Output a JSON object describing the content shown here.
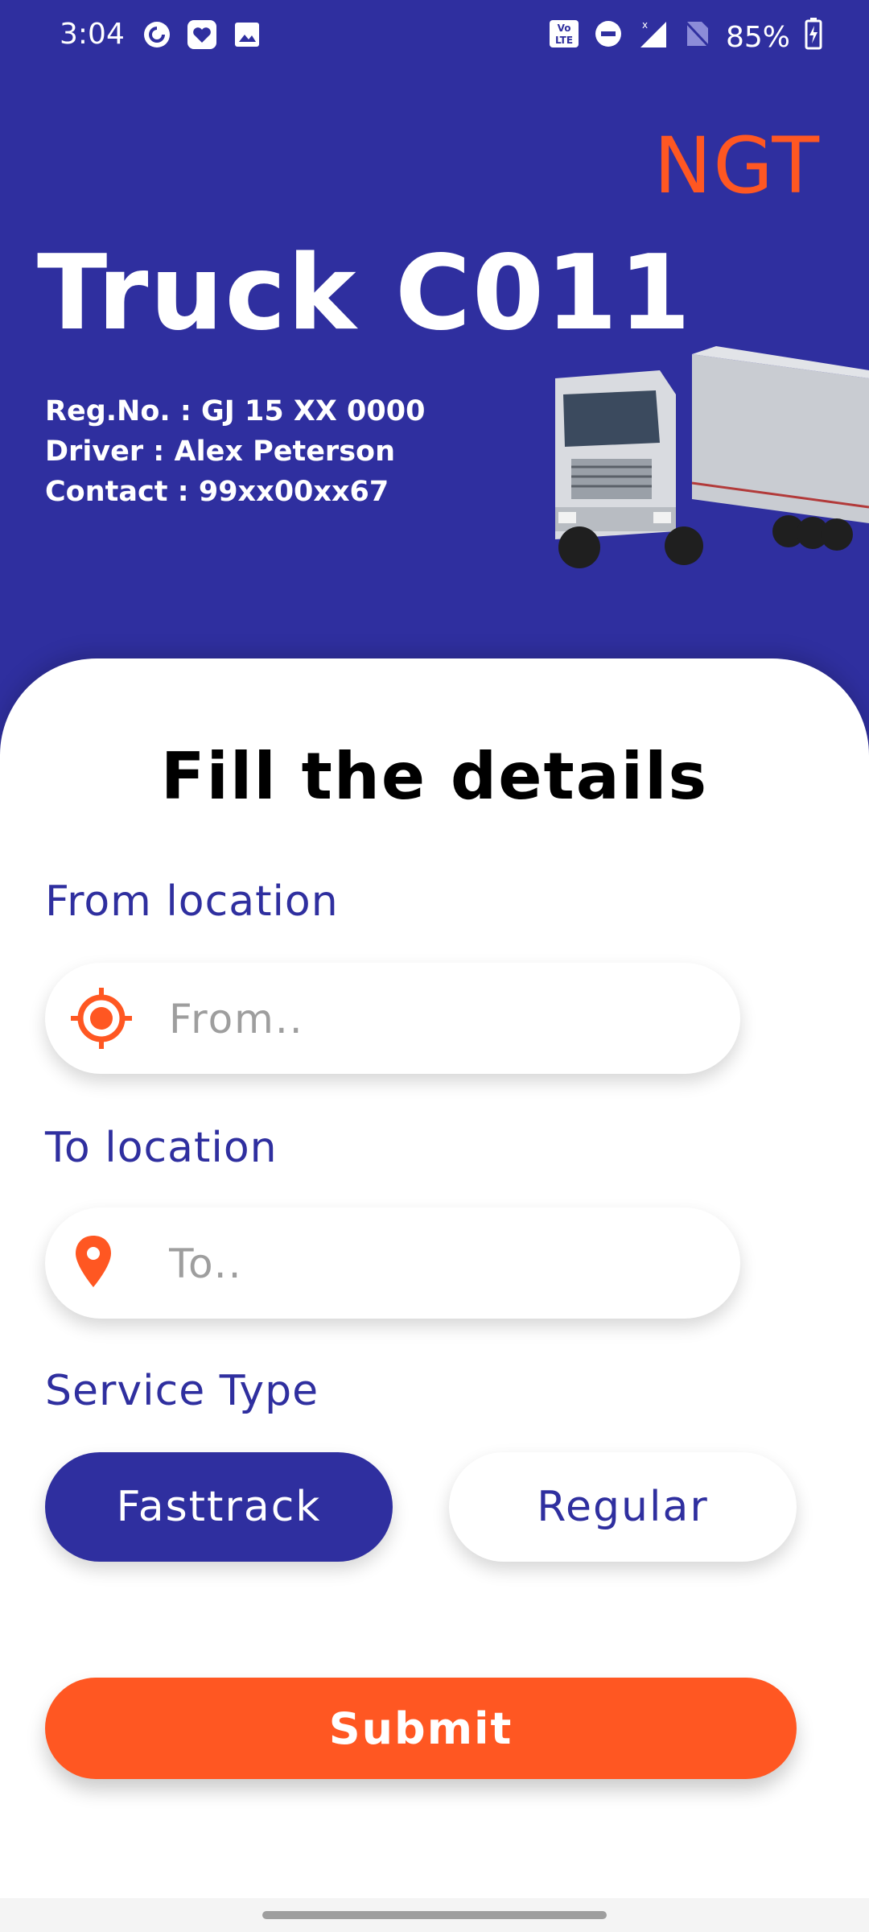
{
  "status_bar": {
    "time": "3:04",
    "battery": "85%",
    "network_badge": "Vo LTE",
    "left_icons": [
      "pocket-casts-icon",
      "heart-app-icon",
      "image-icon"
    ],
    "right_icons": [
      "volte-icon",
      "do-not-disturb-icon",
      "signal-icon",
      "no-sim-icon",
      "battery-charging-icon"
    ]
  },
  "header": {
    "brand": "NGT",
    "title": "Truck C011",
    "reg_no": "Reg.No. : GJ 15 XX 0000",
    "driver": "Driver : Alex Peterson",
    "contact": "Contact : 99xx00xx67"
  },
  "form": {
    "title": "Fill the details",
    "from_label": "From location",
    "from_placeholder": "From..",
    "from_value": "",
    "to_label": "To location",
    "to_placeholder": "To..",
    "to_value": "",
    "service_label": "Service Type",
    "service_options": [
      "Fasttrack",
      "Regular"
    ],
    "service_selected": "Fasttrack",
    "submit_label": "Submit"
  },
  "colors": {
    "primary": "#2f2f9f",
    "accent": "#ff5722",
    "card": "#ffffff"
  }
}
